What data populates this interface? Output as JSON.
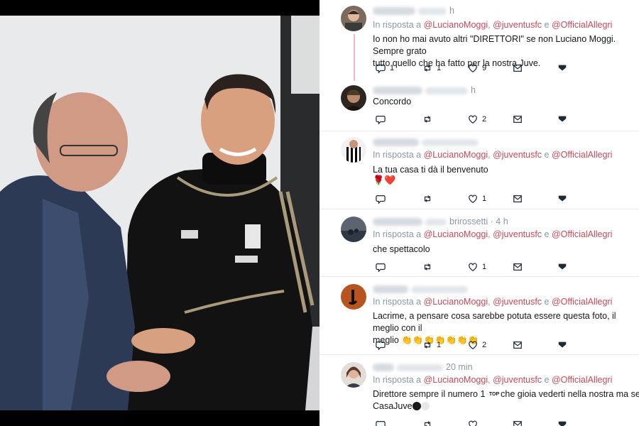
{
  "tweets": [
    {
      "time": "h",
      "reply_prefix": "In risposta a",
      "mentions": [
        "@LucianoMoggi",
        "@juventusfc",
        "@OfficialAllegri"
      ],
      "mention_sep": ",",
      "mention_and": "e",
      "text_line1": "Io non ho mai avuto altri \"DIRETTORI\" se non Luciano Moggi. Sempre grato",
      "text_line2": "tutto quello che ha fatto per la nostra Juve.",
      "replies": "1",
      "retweets": "1",
      "likes": "9"
    },
    {
      "time": "h",
      "text": "Concordo",
      "replies": "",
      "retweets": "",
      "likes": "2"
    },
    {
      "reply_prefix": "In risposta a",
      "mentions": [
        "@LucianoMoggi",
        "@juventusfc",
        "@OfficialAllegri"
      ],
      "text": "La tua casa ti dà il benvenuto",
      "emoji": "🌹❤️",
      "replies": "",
      "retweets": "",
      "likes": "1"
    },
    {
      "handle_suffix": "brirossetti",
      "time": "· 4 h",
      "reply_prefix": "In risposta a",
      "mentions": [
        "@LucianoMoggi",
        "@juventusfc",
        "@OfficialAllegri"
      ],
      "text": "che spettacolo",
      "replies": "",
      "retweets": "",
      "likes": "1"
    },
    {
      "reply_prefix": "In risposta a",
      "mentions": [
        "@LucianoMoggi",
        "@juventusfc",
        "@OfficialAllegri"
      ],
      "text_line1": "Lacrime, a pensare cosa sarebbe potuta essere questa foto, il meglio con il",
      "text_line2": "meglio",
      "emoji": "👏👏👏👏👏👏👏",
      "replies": "",
      "retweets": "1",
      "likes": "2"
    },
    {
      "time": "20 min",
      "reply_prefix": "In risposta a",
      "mentions": [
        "@LucianoMoggi",
        "@juventusfc",
        "@OfficialAllegri"
      ],
      "text_line1a": "Direttore sempre il numero 1",
      "top_badge": "TOP",
      "text_line1b": "che gioia vederti nella nostra ma sempre tu",
      "text_line2": "CasaJuve"
    }
  ],
  "colors": {
    "mention": "#c94a5a",
    "muted": "#8a98a5",
    "thread_line": "#f3b8c2",
    "divider": "#e6ecf0"
  },
  "icons": [
    "reply-icon",
    "retweet-icon",
    "like-icon",
    "message-icon",
    "bookmark-icon"
  ]
}
